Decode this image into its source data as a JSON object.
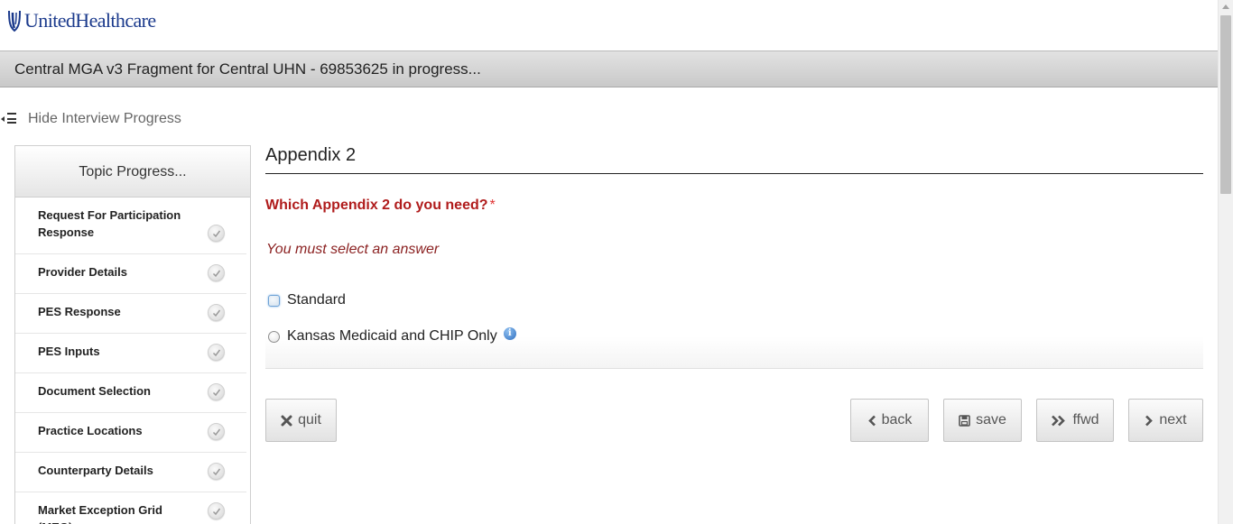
{
  "brand": {
    "name": "UnitedHealthcare",
    "color": "#1b3a8c"
  },
  "title_bar": {
    "text": "Central MGA v3 Fragment for Central UHN - 69853625 in progress..."
  },
  "progress_toggle": {
    "label": "Hide Interview Progress",
    "icon": "collapse-menu-icon"
  },
  "topic_progress": {
    "heading": "Topic Progress...",
    "items": [
      {
        "label": "Request For Participation Response",
        "status": "complete"
      },
      {
        "label": "Provider Details",
        "status": "complete"
      },
      {
        "label": "PES Response",
        "status": "complete"
      },
      {
        "label": "PES Inputs",
        "status": "complete"
      },
      {
        "label": "Document Selection",
        "status": "complete"
      },
      {
        "label": "Practice Locations",
        "status": "complete"
      },
      {
        "label": "Counterparty Details",
        "status": "complete"
      },
      {
        "label": "Market Exception Grid (MEG)",
        "status": "complete"
      }
    ]
  },
  "main": {
    "section_title": "Appendix 2",
    "question": "Which Appendix 2 do you need?",
    "required_marker": "*",
    "error_message": "You must select an answer",
    "options": [
      {
        "label": "Standard",
        "selected": false,
        "focused": true
      },
      {
        "label": "Kansas Medicaid and CHIP Only",
        "selected": false,
        "has_info_icon": true
      }
    ],
    "info_icon_glyph": "i"
  },
  "buttons": {
    "quit": {
      "label": "quit",
      "icon": "close-icon"
    },
    "back": {
      "label": "back",
      "icon": "chevron-left-icon"
    },
    "save": {
      "label": "save",
      "icon": "floppy-disk-icon"
    },
    "ffwd": {
      "label": "ffwd",
      "icon": "double-chevron-right-icon"
    },
    "next": {
      "label": "next",
      "icon": "chevron-right-icon"
    }
  },
  "colors": {
    "question": "#b01c1c",
    "required": "#e03434",
    "error": "#8c2323",
    "info_icon": "#2f6fc0"
  }
}
